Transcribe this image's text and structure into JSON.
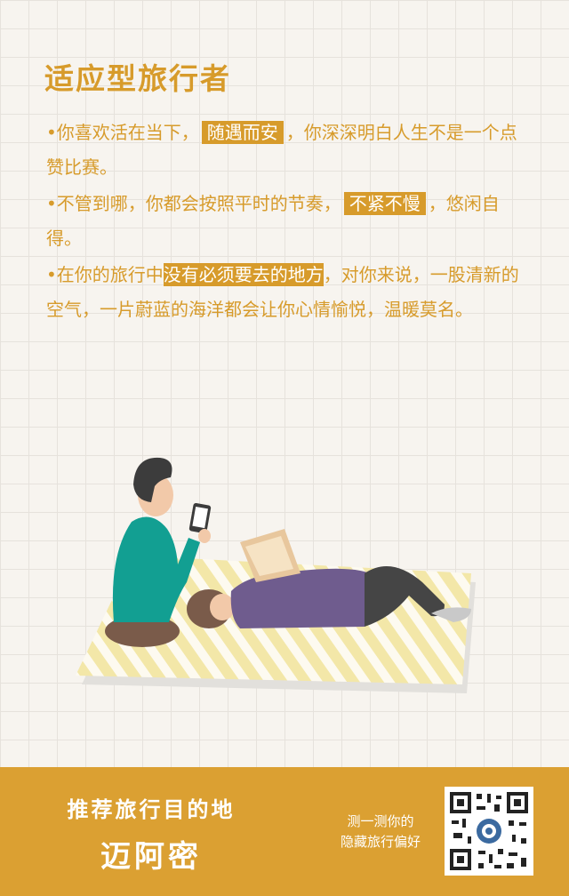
{
  "title": "适应型旅行者",
  "p1": {
    "a": "•你喜欢活在当下，",
    "hl": "随遇而安",
    "b": "，你深深明白人生不是一个点赞比赛。"
  },
  "p2": {
    "a": "•不管到哪，你都会按照平时的节奏，",
    "hl": "不紧不慢",
    "b": "，悠闲自得。"
  },
  "p3": {
    "a": "•在你的旅行中",
    "hl": "没有必须要去的地方",
    "b": "，对你来说，一股清新的空气，一片蔚蓝的海洋都会让你心情愉悦，温暖莫名。"
  },
  "footer": {
    "recommend_label": "推荐旅行目的地",
    "destination": "迈阿密",
    "test_line1": "测一测你的",
    "test_line2": "隐藏旅行偏好"
  },
  "colors": {
    "accent": "#d79b2b",
    "footer": "#dba032",
    "background": "#f7f4ef"
  },
  "icons": [
    "qr-code-icon"
  ]
}
